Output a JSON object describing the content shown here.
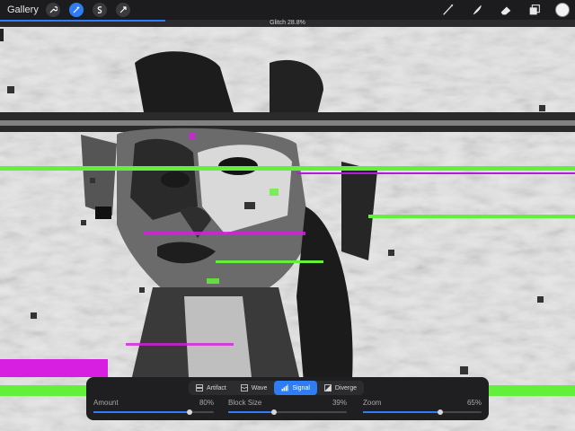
{
  "topbar": {
    "gallery_label": "Gallery",
    "left_tools": [
      {
        "icon": "wrench-icon",
        "state": "normal"
      },
      {
        "icon": "magic-wand-icon",
        "state": "active"
      },
      {
        "icon": "s-curve-icon",
        "state": "normal"
      },
      {
        "icon": "arrow-cursor-icon",
        "state": "normal"
      }
    ],
    "right_tools": [
      "brush-icon",
      "smudge-icon",
      "eraser-icon",
      "layers-icon"
    ],
    "current_color": "#f2f2f2"
  },
  "status": {
    "label": "Glitch 28.8%",
    "progress": 0.288
  },
  "panel": {
    "modes": [
      {
        "label": "Artifact",
        "icon": "artifact-icon",
        "active": false
      },
      {
        "label": "Wave",
        "icon": "wave-icon",
        "active": false
      },
      {
        "label": "Signal",
        "icon": "signal-icon",
        "active": true
      },
      {
        "label": "Diverge",
        "icon": "diverge-icon",
        "active": false
      }
    ],
    "sliders": [
      {
        "label": "Amount",
        "value_text": "80%",
        "value": 0.8
      },
      {
        "label": "Block Size",
        "value_text": "39%",
        "value": 0.39
      },
      {
        "label": "Zoom",
        "value_text": "65%",
        "value": 0.65
      }
    ]
  },
  "colors": {
    "accent": "#2f7df6",
    "glitch_magenta": "#d61fe0",
    "glitch_green": "#63f03a"
  }
}
